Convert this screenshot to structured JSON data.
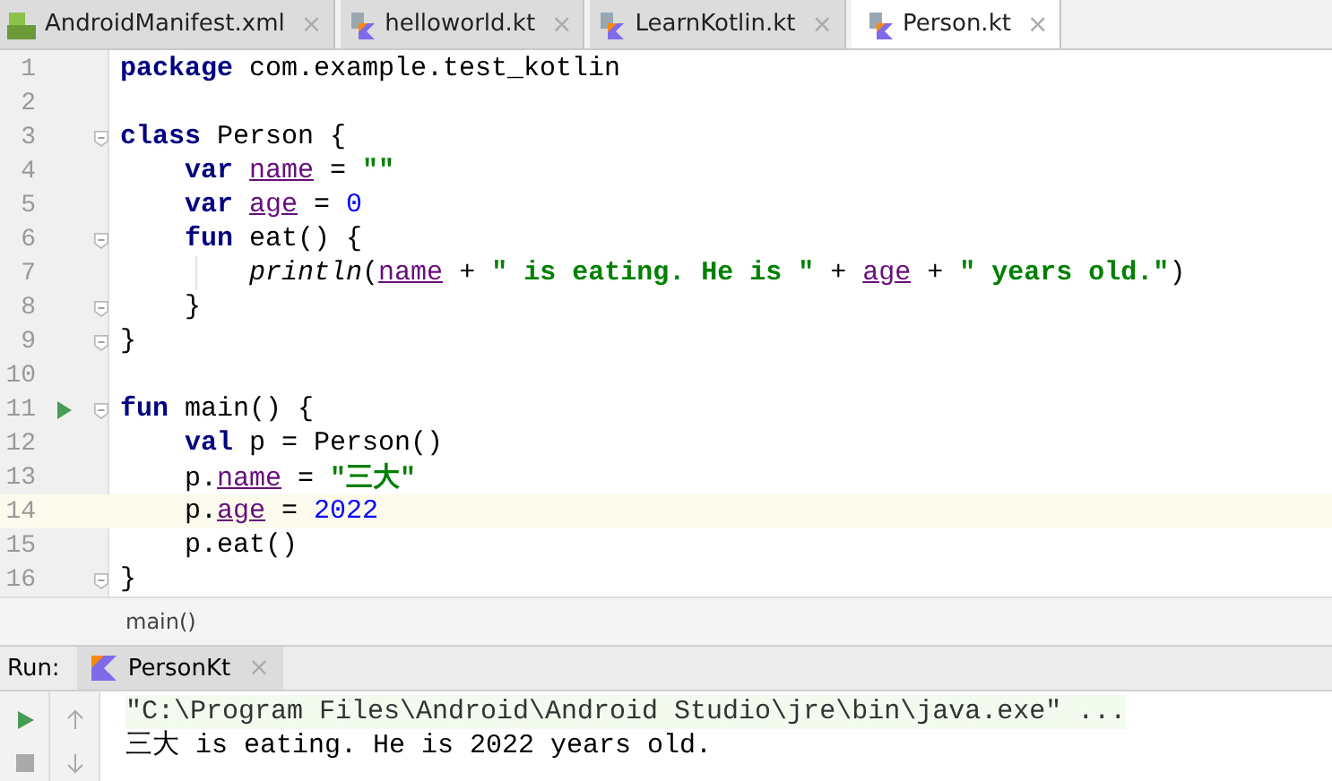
{
  "tabs": [
    {
      "label": "AndroidManifest.xml",
      "kind": "manifest",
      "selected": false,
      "close": "×"
    },
    {
      "label": "helloworld.kt",
      "kind": "kotlin",
      "selected": false,
      "close": "×"
    },
    {
      "label": "LearnKotlin.kt",
      "kind": "kotlin",
      "selected": false,
      "close": "×"
    },
    {
      "label": "Person.kt",
      "kind": "kotlin",
      "selected": true,
      "close": "×"
    }
  ],
  "editor": {
    "lines": [
      {
        "number": "1",
        "fold": false,
        "run": false,
        "current": false,
        "guide": false,
        "tokens": [
          {
            "t": "package ",
            "kind": "keyword"
          },
          {
            "t": "com.example.test_kotlin",
            "kind": "plain"
          }
        ]
      },
      {
        "number": "2",
        "fold": false,
        "run": false,
        "current": false,
        "guide": false
      },
      {
        "number": "3",
        "fold": true,
        "run": false,
        "current": false,
        "guide": false,
        "tokens": [
          {
            "t": "class ",
            "kind": "keyword"
          },
          {
            "t": "Person {",
            "kind": "plain"
          }
        ]
      },
      {
        "number": "4",
        "fold": false,
        "run": false,
        "current": false,
        "guide": false,
        "tokens": [
          {
            "t": "    var ",
            "kind": "keyword"
          },
          {
            "t": "name",
            "kind": "property"
          },
          {
            "t": " = ",
            "kind": "plain"
          },
          {
            "t": "\"\"",
            "kind": "string"
          }
        ]
      },
      {
        "number": "5",
        "fold": false,
        "run": false,
        "current": false,
        "guide": false,
        "tokens": [
          {
            "t": "    var ",
            "kind": "keyword"
          },
          {
            "t": "age",
            "kind": "property"
          },
          {
            "t": " = ",
            "kind": "plain"
          },
          {
            "t": "0",
            "kind": "number"
          }
        ]
      },
      {
        "number": "6",
        "fold": true,
        "run": false,
        "current": false,
        "guide": false,
        "tokens": [
          {
            "t": "    fun ",
            "kind": "keyword"
          },
          {
            "t": "eat() {",
            "kind": "plain"
          }
        ]
      },
      {
        "number": "7",
        "fold": false,
        "run": false,
        "current": false,
        "guide": true,
        "tokens": [
          {
            "t": "        println",
            "kind": "call"
          },
          {
            "t": "(",
            "kind": "plain"
          },
          {
            "t": "name",
            "kind": "property"
          },
          {
            "t": " + ",
            "kind": "plain"
          },
          {
            "t": "\" is eating. He is \"",
            "kind": "string"
          },
          {
            "t": " + ",
            "kind": "plain"
          },
          {
            "t": "age",
            "kind": "property"
          },
          {
            "t": " + ",
            "kind": "plain"
          },
          {
            "t": "\" years old.\"",
            "kind": "string"
          },
          {
            "t": ")",
            "kind": "plain"
          }
        ]
      },
      {
        "number": "8",
        "fold": true,
        "run": false,
        "current": false,
        "guide": false,
        "tokens": [
          {
            "t": "    }",
            "kind": "plain"
          }
        ]
      },
      {
        "number": "9",
        "fold": true,
        "run": false,
        "current": false,
        "guide": false,
        "tokens": [
          {
            "t": "}",
            "kind": "plain"
          }
        ]
      },
      {
        "number": "10",
        "fold": false,
        "run": false,
        "current": false,
        "guide": false
      },
      {
        "number": "11",
        "fold": true,
        "run": true,
        "current": false,
        "guide": false,
        "tokens": [
          {
            "t": "fun ",
            "kind": "keyword"
          },
          {
            "t": "main() {",
            "kind": "plain"
          }
        ]
      },
      {
        "number": "12",
        "fold": false,
        "run": false,
        "current": false,
        "guide": false,
        "tokens": [
          {
            "t": "    val ",
            "kind": "keyword"
          },
          {
            "t": "p = Person()",
            "kind": "plain"
          }
        ]
      },
      {
        "number": "13",
        "fold": false,
        "run": false,
        "current": false,
        "guide": false,
        "tokens": [
          {
            "t": "    p.",
            "kind": "plain"
          },
          {
            "t": "name",
            "kind": "property"
          },
          {
            "t": " = ",
            "kind": "plain"
          },
          {
            "t": "\"三大\"",
            "kind": "string"
          }
        ]
      },
      {
        "number": "14",
        "fold": false,
        "run": false,
        "current": true,
        "guide": false,
        "tokens": [
          {
            "t": "    p.",
            "kind": "plain"
          },
          {
            "t": "age",
            "kind": "property"
          },
          {
            "t": " = ",
            "kind": "plain"
          },
          {
            "t": "2022",
            "kind": "number"
          }
        ]
      },
      {
        "number": "15",
        "fold": false,
        "run": false,
        "current": false,
        "guide": false,
        "tokens": [
          {
            "t": "    p.eat()",
            "kind": "plain"
          }
        ]
      },
      {
        "number": "16",
        "fold": true,
        "run": false,
        "current": false,
        "guide": false,
        "tokens": [
          {
            "t": "}",
            "kind": "plain"
          }
        ]
      }
    ]
  },
  "breadcrumb": "main()",
  "run": {
    "label": "Run:",
    "tab": {
      "label": "PersonKt",
      "close": "×"
    },
    "console": [
      {
        "kind": "command",
        "text": "\"C:\\Program Files\\Android\\Android Studio\\jre\\bin\\java.exe\" ..."
      },
      {
        "kind": "output",
        "text": "三大 is eating. He is 2022 years old."
      }
    ]
  }
}
